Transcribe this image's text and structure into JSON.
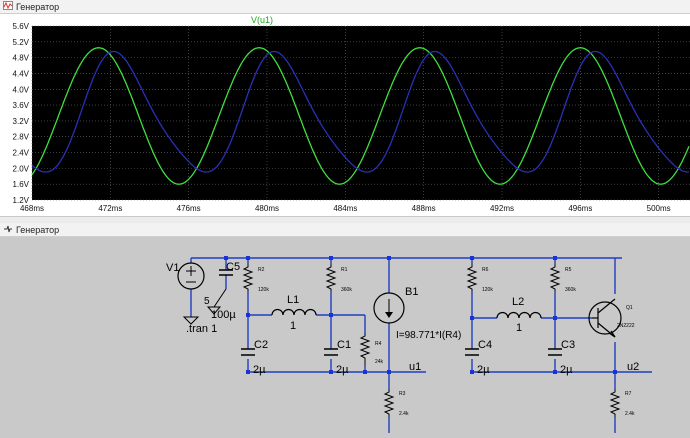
{
  "plot_window": {
    "title": "Генератор"
  },
  "schematic_window": {
    "title": "Генератор"
  },
  "trace_label": "V(u1)",
  "colors": {
    "green": "#3fe03f",
    "blue": "#2b2fb8",
    "grid": "#666666",
    "plot_bg": "#000000",
    "schematic_bg": "#c9c9c9",
    "wire": "#1f3fc0",
    "node": "#1a33d6"
  },
  "chart_data": {
    "type": "line",
    "title": "V(u1)",
    "y_ticks": [
      "5.6V",
      "5.2V",
      "4.8V",
      "4.4V",
      "4.0V",
      "3.6V",
      "3.2V",
      "2.8V",
      "2.4V",
      "2.0V",
      "1.6V",
      "1.2V"
    ],
    "x_ticks": [
      "468ms",
      "472ms",
      "476ms",
      "480ms",
      "484ms",
      "488ms",
      "492ms",
      "496ms",
      "500ms"
    ],
    "xlim": [
      468,
      501.6
    ],
    "ylim": [
      1.2,
      5.6
    ],
    "series": [
      {
        "name": "V(u1)",
        "color": "#3fe03f",
        "period_ms": 8.2,
        "peak_ms": 471.4,
        "min": 1.6,
        "max": 5.05
      },
      {
        "color": "#2b2fb8",
        "period_ms": 8.2,
        "peak_ms": 472.4,
        "min": 1.7,
        "max": 4.95
      }
    ]
  },
  "schematic": {
    "components": {
      "V1": "V1",
      "V1_value": "5",
      "C5": "C5",
      "C5_value": "100µ",
      "tran": ".tran 1",
      "R2": "R2",
      "R2_value": "120k",
      "R1": "R1",
      "R1_value": "360k",
      "L1": "L1",
      "L1_value": "1",
      "C2": "C2",
      "C2_value": "2µ",
      "C1": "C1",
      "C1_value": "2µ",
      "R4": "R4",
      "R4_value": "24k",
      "B1": "B1",
      "B1_expr": "I=98.771*I(R4)",
      "u1": "u1",
      "R3": "R3",
      "R3_value": "2.4k",
      "R6": "R6",
      "R6_value": "120k",
      "R5": "R5",
      "R5_value": "360k",
      "L2": "L2",
      "L2_value": "1",
      "C4": "C4",
      "C4_value": "2µ",
      "C3": "C3",
      "C3_value": "2µ",
      "Q1": "Q1",
      "Q1_model": "2N2222",
      "u2": "u2",
      "R7": "R7",
      "R7_value": "2.4k"
    }
  }
}
